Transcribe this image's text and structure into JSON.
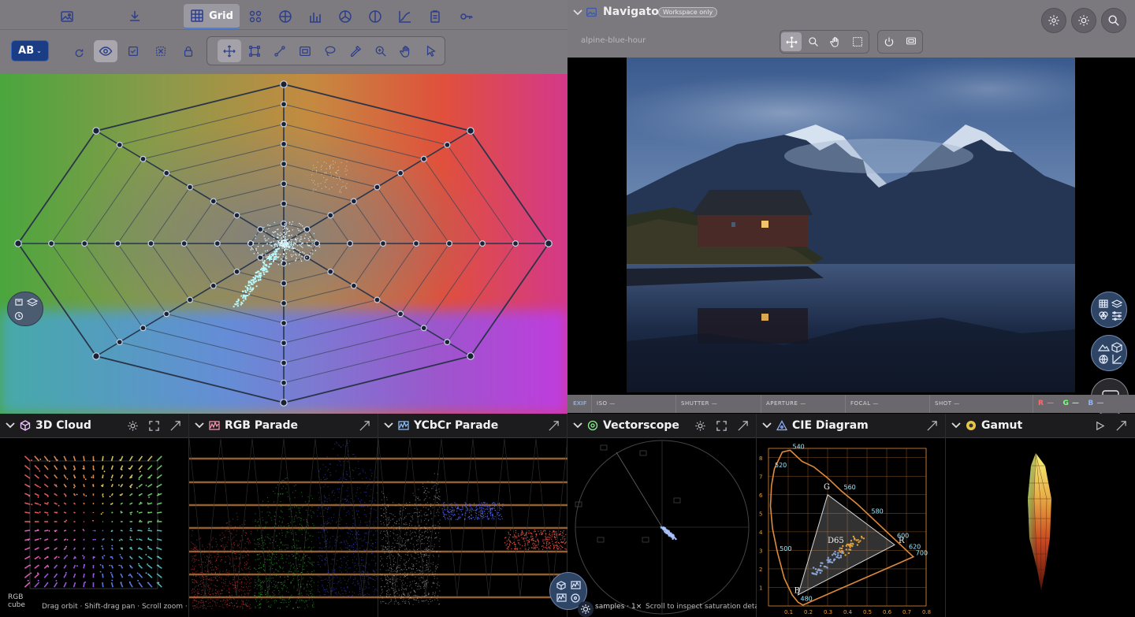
{
  "toolbar": {
    "grid_tab_label": "Grid",
    "ab_label": "AB",
    "top_icons": [
      "image-icon",
      "download-icon",
      "grid-icon",
      "cluster-icon",
      "target-icon",
      "histogram-icon",
      "wheel-icon",
      "balance-icon",
      "curve-icon",
      "clipboard-icon",
      "key-icon"
    ],
    "tool_icons": [
      "move-icon",
      "transform-icon",
      "link-icon",
      "frame-icon",
      "lasso-icon",
      "eyedropper-icon",
      "zoom-icon",
      "hand-icon",
      "pointer-icon"
    ]
  },
  "navigator": {
    "title": "Navigator",
    "workspace_badge": "Workspace only",
    "image_name": "alpine-blue-hour"
  },
  "exif": {
    "label": "EXIF",
    "iso": "ISO —",
    "shutter": "SHUTTER —",
    "aperture": "APERTURE —",
    "focal": "FOCAL —",
    "shot": "SHOT —",
    "channels": [
      {
        "name": "R —",
        "color": "#ff6a6a"
      },
      {
        "name": "G —",
        "color": "#7cff7c"
      },
      {
        "name": "B —",
        "color": "#8fb2ff"
      }
    ]
  },
  "panels": {
    "cloud": {
      "title": "3D Cloud",
      "cube_label": "RGB cube",
      "hint": "Drag orbit · Shift-drag pan · Scroll zoom · ..."
    },
    "parade": {
      "title": "RGB Parade"
    },
    "ycbcr": {
      "title": "YCbCr Parade"
    },
    "vectorscope": {
      "title": "Vectorscope",
      "samples": "samples · 1×",
      "hint": "Scroll to inspect saturation detail"
    },
    "cie": {
      "title": "CIE Diagram",
      "wavelengths": [
        "540",
        "560",
        "520",
        "580",
        "600",
        "620",
        "700",
        "500",
        "480"
      ],
      "primaries": [
        "G",
        "B",
        "D65",
        "R"
      ],
      "x_ticks": [
        "0.1",
        "0.2",
        "0.3",
        "0.4",
        "0.5",
        "0.6",
        "0.7",
        "0.8"
      ],
      "y_ticks": [
        "8",
        "7",
        "6",
        "5",
        "4",
        "3",
        "2",
        "1"
      ]
    },
    "gamut": {
      "title": "Gamut"
    }
  },
  "colors": {
    "accent": "#4d7fd6",
    "ab_button": "#1b3d86",
    "panel_header": "#1c1c1f",
    "cie_locus": "#e08a3a"
  }
}
